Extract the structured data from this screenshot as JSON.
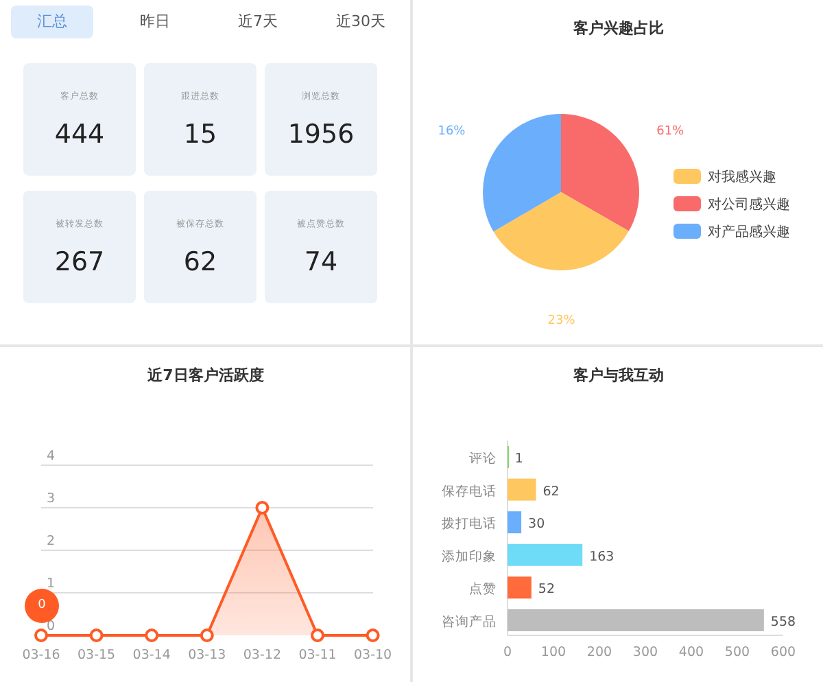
{
  "summary": {
    "tabs": [
      {
        "label": "汇总",
        "selected": true
      },
      {
        "label": "昨日",
        "selected": false
      },
      {
        "label": "近7天",
        "selected": false
      },
      {
        "label": "近30天",
        "selected": false
      }
    ],
    "stats": [
      {
        "label": "客户总数",
        "value": "444"
      },
      {
        "label": "跟进总数",
        "value": "15"
      },
      {
        "label": "浏览总数",
        "value": "1956"
      },
      {
        "label": "被转发总数",
        "value": "267"
      },
      {
        "label": "被保存总数",
        "value": "62"
      },
      {
        "label": "被点赞总数",
        "value": "74"
      }
    ]
  },
  "interest": {
    "chart_data": {
      "type": "pie",
      "title": "客户兴趣占比",
      "categories": [
        "对我感兴趣",
        "对公司感兴趣",
        "对产品感兴趣"
      ],
      "series": [
        {
          "colors": [
            "#ffc75f",
            "#f96b6b",
            "#6aaefc"
          ],
          "values": [
            33.3,
            33.3,
            33.4
          ]
        }
      ],
      "value_labels": [
        "23%",
        "61%",
        "16%"
      ],
      "legend": true
    }
  },
  "activity": {
    "chart_data": {
      "type": "area",
      "title": "近7日客户活跃度",
      "categories": [
        "03-16",
        "03-15",
        "03-14",
        "03-13",
        "03-12",
        "03-11",
        "03-10"
      ],
      "series": [
        {
          "color": "#fe5b25",
          "values": [
            0,
            0,
            0,
            0,
            3,
            0,
            0
          ]
        }
      ],
      "ylim": [
        0,
        4
      ],
      "yticks": [
        0,
        1,
        2,
        3,
        4
      ],
      "grid": true
    },
    "tooltip": "0"
  },
  "interaction": {
    "chart_data": {
      "type": "bar",
      "orientation": "horizontal",
      "title": "客户与我互动",
      "categories": [
        "评论",
        "保存电话",
        "拨打电话",
        "添加印象",
        "点赞",
        "咨询产品"
      ],
      "series": [
        {
          "colors": [
            "#8ad36b",
            "#ffc75f",
            "#6aaefc",
            "#6fdcf7",
            "#ff6b3b",
            "#bdbdbd"
          ],
          "values": [
            1,
            62,
            30,
            163,
            52,
            558
          ]
        }
      ],
      "xlim": [
        0,
        600
      ],
      "xticks": [
        0,
        100,
        200,
        300,
        400,
        500,
        600
      ],
      "data_labels": true
    }
  }
}
